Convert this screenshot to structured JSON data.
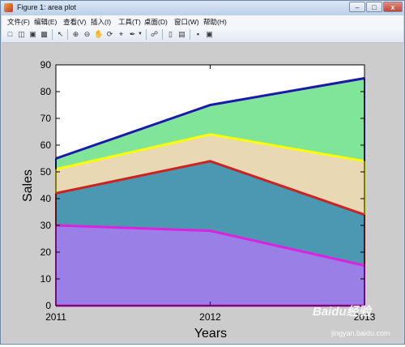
{
  "window": {
    "title": "Figure 1: area plot",
    "btn_min": "–",
    "btn_max": "□",
    "btn_close": "x"
  },
  "menu": [
    {
      "label": "文件(F)",
      "key": "file"
    },
    {
      "label": "编辑(E)",
      "key": "edit"
    },
    {
      "label": "查看(V)",
      "key": "view"
    },
    {
      "label": "插入(I)",
      "key": "insert"
    },
    {
      "label": "工具(T)",
      "key": "tools"
    },
    {
      "label": "桌面(D)",
      "key": "desktop"
    },
    {
      "label": "窗口(W)",
      "key": "window"
    },
    {
      "label": "帮助(H)",
      "key": "help"
    }
  ],
  "toolbar": {
    "icons": [
      "new-file-icon",
      "open-file-icon",
      "save-icon",
      "print-icon",
      "pointer-icon",
      "zoom-in-icon",
      "zoom-out-icon",
      "pan-icon",
      "rotate-icon",
      "data-cursor-icon",
      "brush-icon",
      "link-icon",
      "colorbar-icon",
      "legend-icon",
      "hide-tools-icon",
      "show-tools-icon"
    ]
  },
  "watermark": {
    "brand": "Baidu经验",
    "url": "jingyan.baidu.com"
  },
  "chart_data": {
    "type": "area",
    "categories": [
      "2011",
      "2012",
      "2013"
    ],
    "series": [
      {
        "values": [
          30,
          28,
          15
        ],
        "fill": "#9a7fe6",
        "line": "#dd22dd"
      },
      {
        "values": [
          12,
          26,
          19
        ],
        "fill": "#4a98b1",
        "line": "#cc2222"
      },
      {
        "values": [
          9,
          10,
          20
        ],
        "fill": "#e8d9b4",
        "line": "#ffff00"
      },
      {
        "values": [
          4,
          11,
          31
        ],
        "fill": "#80e598",
        "line": "#1a1aa8"
      }
    ],
    "xlabel": "Years",
    "ylabel": "Sales",
    "ylim": [
      0,
      90
    ],
    "yticks": [
      0,
      10,
      20,
      30,
      40,
      50,
      60,
      70,
      80,
      90
    ],
    "xtick_labels": [
      "2011",
      "2012",
      "2013"
    ],
    "grid": false,
    "stacked": true
  }
}
